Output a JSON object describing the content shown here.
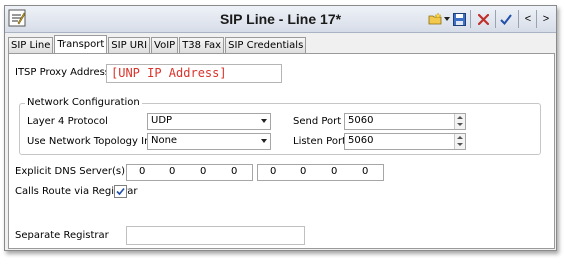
{
  "window": {
    "title": "SIP Line - Line 17*"
  },
  "tabs": [
    {
      "label": "SIP Line",
      "active": false
    },
    {
      "label": "Transport",
      "active": true
    },
    {
      "label": "SIP URI",
      "active": false
    },
    {
      "label": "VoIP",
      "active": false
    },
    {
      "label": "T38 Fax",
      "active": false
    },
    {
      "label": "SIP Credentials",
      "active": false
    }
  ],
  "toolbar": {
    "prev_label": "<",
    "next_label": ">"
  },
  "form": {
    "itsp_proxy_label": "ITSP Proxy Address",
    "itsp_proxy_value": "[UNP IP Address]",
    "network_group_title": "Network Configuration",
    "layer4_label": "Layer 4 Protocol",
    "layer4_value": "UDP",
    "topology_label": "Use Network Topology Info",
    "topology_value": "None",
    "send_port_label": "Send Port",
    "send_port_value": "5060",
    "listen_port_label": "Listen Port",
    "listen_port_value": "5060",
    "dns_label": "Explicit DNS Server(s)",
    "dns1": [
      "0",
      "0",
      "0",
      "0"
    ],
    "dns2": [
      "0",
      "0",
      "0",
      "0"
    ],
    "calls_route_label": "Calls Route via Registrar",
    "calls_route_checked": true,
    "separate_registrar_label": "Separate Registrar",
    "separate_registrar_value": ""
  },
  "colors": {
    "placeholder_red": "#d9342b",
    "check_blue": "#1f4fa8"
  }
}
